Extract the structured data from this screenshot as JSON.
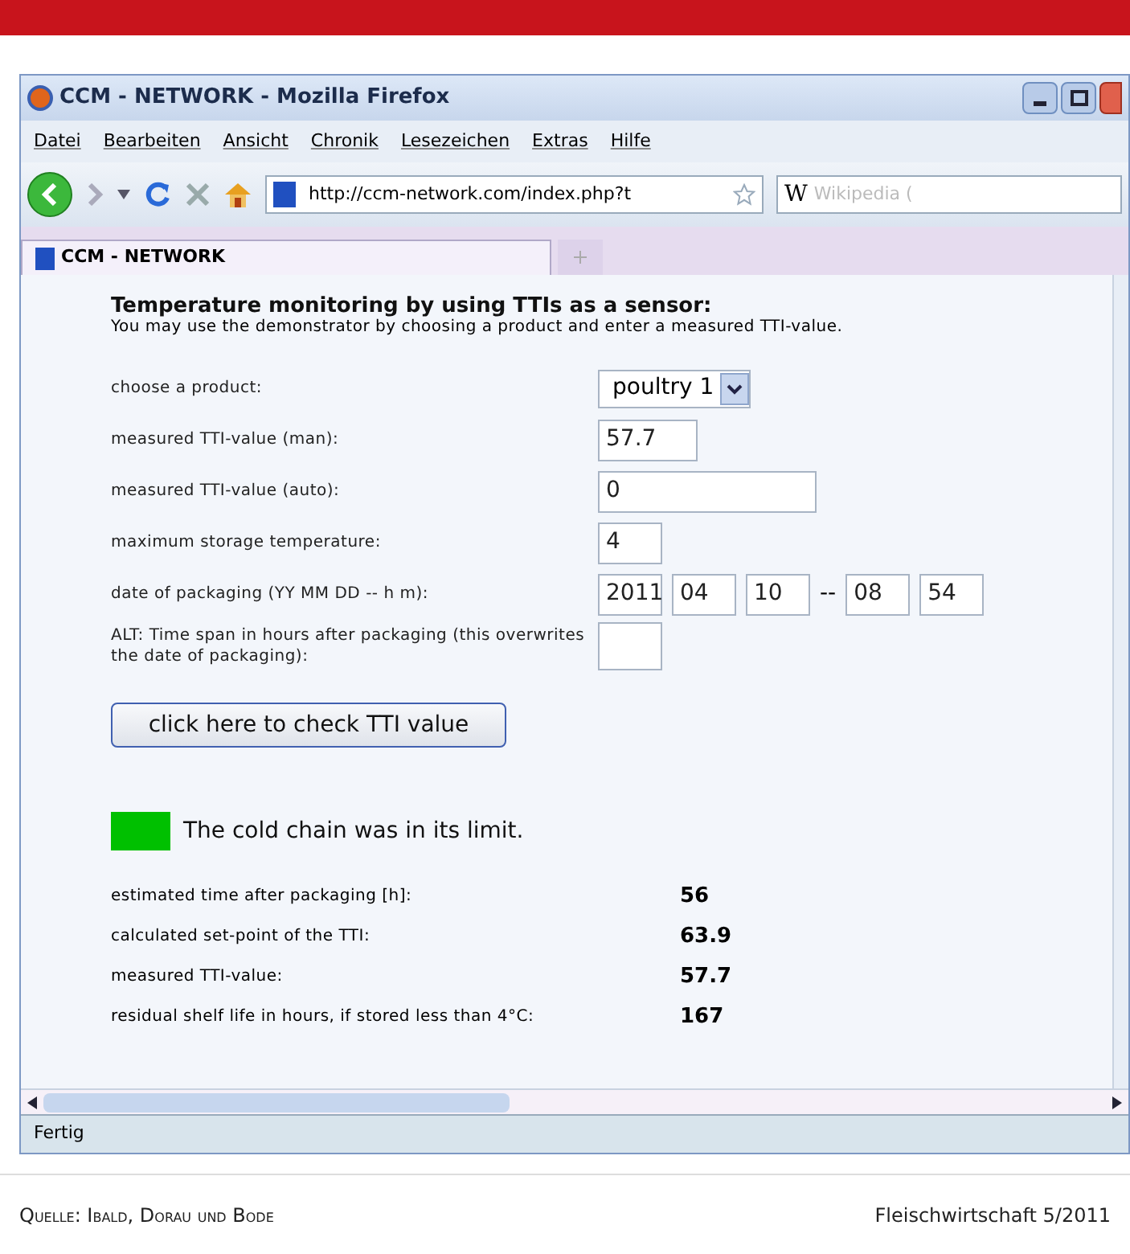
{
  "window": {
    "title": "CCM - NETWORK - Mozilla Firefox"
  },
  "menu": [
    "Datei",
    "Bearbeiten",
    "Ansicht",
    "Chronik",
    "Lesezeichen",
    "Extras",
    "Hilfe"
  ],
  "address_bar": {
    "value": "http://ccm-network.com/index.php?t"
  },
  "search": {
    "placeholder": "Wikipedia (",
    "engine": "W"
  },
  "tabs": [
    {
      "label": "CCM - NETWORK",
      "selected": true
    }
  ],
  "page": {
    "heading": "Temperature monitoring by using TTIs as a sensor:",
    "intro": "You may use the demonstrator by choosing a product and enter a measured TTI-value.",
    "form": [
      {
        "kind": "select",
        "label": "choose a product:",
        "value": "poultry 1"
      },
      {
        "kind": "field",
        "label": "measured TTI-value (man):",
        "values": [
          "57.7"
        ]
      },
      {
        "kind": "widefield",
        "label": "measured TTI-value (auto):",
        "values": [
          "0"
        ]
      },
      {
        "kind": "shortfield",
        "label": "maximum storage temperature:",
        "values": [
          "4"
        ]
      },
      {
        "kind": "date",
        "label": "date of packaging (YY MM DD -- h m):",
        "values": [
          "2011",
          "04",
          "10",
          "08",
          "54"
        ],
        "separator": "--"
      },
      {
        "kind": "shortfield",
        "label": "ALT: Time span in hours after packaging (this overwrites the date of packaging):"
      }
    ],
    "button": "click here to check TTI value",
    "status": {
      "color": "#00c000",
      "text": "The cold chain was in its limit."
    },
    "results": [
      {
        "label": "estimated time after packaging [h]:",
        "value": "56"
      },
      {
        "label": "calculated set-point of the TTI:",
        "value": "63.9"
      },
      {
        "label": "measured TTI-value:",
        "value": "57.7"
      },
      {
        "label": "residual shelf life in hours, if stored less than 4°C:",
        "value": "167"
      }
    ]
  },
  "status_bar": "Fertig",
  "caption": {
    "source": "Quelle: Ibald, Dorau und Bode",
    "publication": "Fleischwirtschaft 5/2011"
  }
}
